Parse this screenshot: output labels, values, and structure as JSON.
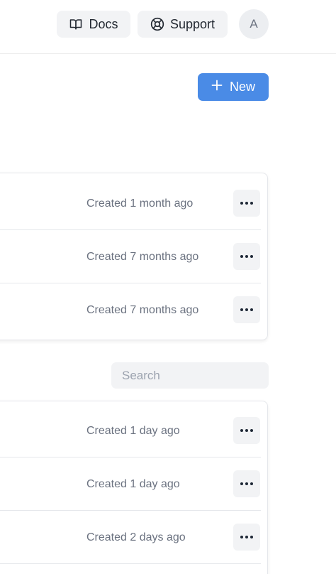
{
  "header": {
    "docs_label": "Docs",
    "support_label": "Support",
    "avatar_initial": "A"
  },
  "actions": {
    "new_label": "New"
  },
  "top_list": {
    "rows": [
      {
        "created": "Created 1 month ago"
      },
      {
        "created": "Created 7 months ago"
      },
      {
        "created": "Created 7 months ago"
      }
    ]
  },
  "search": {
    "placeholder": "Search",
    "value": ""
  },
  "bottom_list": {
    "rows": [
      {
        "created": "Created 1 day ago"
      },
      {
        "created": "Created 1 day ago"
      },
      {
        "created": "Created 2 days ago"
      }
    ]
  },
  "colors": {
    "accent": "#4a8be6",
    "button_bg": "#f2f3f5",
    "muted_text": "#6b7280"
  },
  "icons": {
    "docs": "book-open-icon",
    "support": "lifebuoy-icon",
    "new": "plus-icon",
    "more": "more-horizontal-icon"
  }
}
